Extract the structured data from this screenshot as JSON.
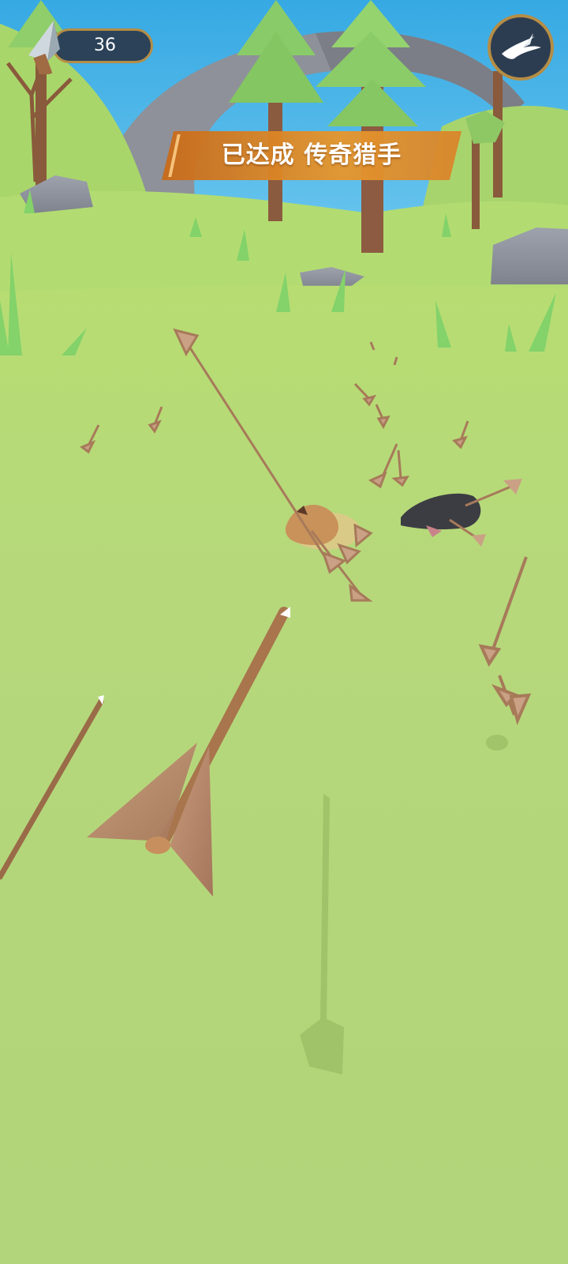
{
  "hud": {
    "arrow_count": "36",
    "arrow_icon": "arrowhead-icon",
    "special_icon": "swallow-bird-icon"
  },
  "banner": {
    "text": "已达成 传奇猎手"
  },
  "colors": {
    "sky": "#3fb2e8",
    "grass": "#b4d57b",
    "hud_panel": "#2b4258",
    "hud_border": "#b58d45",
    "banner_orange": "#e08a26"
  }
}
